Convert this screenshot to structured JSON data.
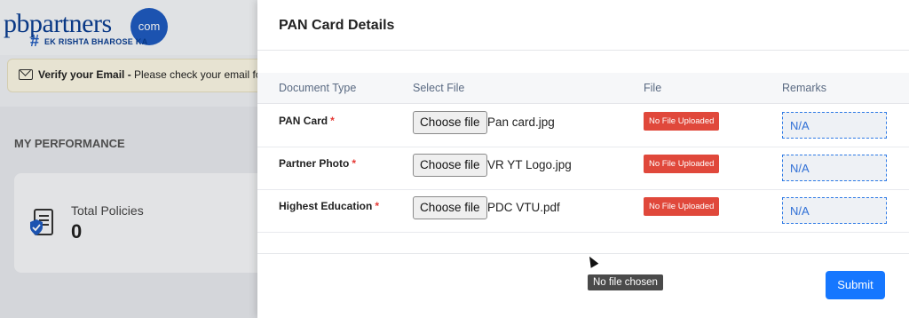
{
  "background": {
    "logo_text": "pbpartners",
    "logo_com": "com",
    "logo_tagline": "EK RISHTA BHAROSE KA",
    "verify_bold": "Verify your Email -",
    "verify_text": " Please check your email for",
    "performance_title": "MY PERFORMANCE",
    "total_policies_label": "Total Policies",
    "total_policies_value": "0"
  },
  "modal": {
    "title": "PAN Card Details",
    "columns": [
      "Document Type",
      "Select File",
      "File",
      "Remarks"
    ],
    "rows": [
      {
        "doc_type": "PAN Card",
        "required": "*",
        "button": "Choose file",
        "file_name": "Pan card.jpg",
        "status": "No File Uploaded",
        "remarks": "N/A"
      },
      {
        "doc_type": "Partner Photo",
        "required": "*",
        "button": "Choose file",
        "file_name": "VR YT Logo.jpg",
        "status": "No File Uploaded",
        "remarks": "N/A"
      },
      {
        "doc_type": "Highest Education",
        "required": "*",
        "button": "Choose file",
        "file_name": "PDC VTU.pdf",
        "status": "No File Uploaded",
        "remarks": "N/A"
      }
    ],
    "submit_label": "Submit",
    "tooltip": "No file chosen"
  },
  "colors": {
    "accent": "#1677ff",
    "badge": "#e0483b",
    "required": "#e53935"
  }
}
